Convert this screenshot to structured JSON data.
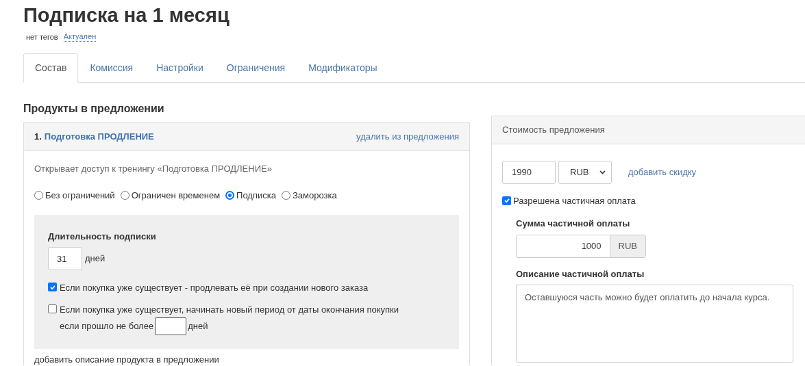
{
  "title": "Подписка на 1 месяц",
  "tags": {
    "label": "нет тегов",
    "status": "Актуален"
  },
  "tabs": [
    {
      "label": "Состав",
      "selected": true
    },
    {
      "label": "Комиссия",
      "selected": false
    },
    {
      "label": "Настройки",
      "selected": false
    },
    {
      "label": "Ограничения",
      "selected": false
    },
    {
      "label": "Модификаторы",
      "selected": false
    }
  ],
  "products": {
    "heading": "Продукты в предложении",
    "items": [
      {
        "number": "1.",
        "name": "Подготовка ПРОДЛЕНИЕ",
        "remove": "удалить из предложения",
        "description": "Открывает доступ к тренингу «Подготовка ПРОДЛЕНИЕ»",
        "access_options": [
          {
            "label": "Без ограничений",
            "selected": false
          },
          {
            "label": "Ограничен временем",
            "selected": false
          },
          {
            "label": "Подписка",
            "selected": true
          },
          {
            "label": "Заморозка",
            "selected": false
          }
        ],
        "subscription": {
          "heading": "Длительность подписки",
          "duration": "31",
          "unit": "дней",
          "options": [
            {
              "label": "Если покупка уже существует - продлевать её при создании нового заказа",
              "checked": true
            },
            {
              "label": "Если покупка уже существует, начинать новый период от даты окончания покупки",
              "label_2": "если прошло не более",
              "unit": "дней",
              "checked": false
            }
          ]
        },
        "add_description": "добавить описание продукта в предложении"
      }
    ]
  },
  "price": {
    "heading": "Стоимость предложения",
    "amount": "1990",
    "currency": "RUB",
    "add_discount": "добавить скидку",
    "partial": {
      "label": "Разрешена частичная оплата",
      "checked": true,
      "amount_label": "Сумма частичной оплаты",
      "amount": "1000",
      "currency": "RUB",
      "description_label": "Описание частичной оплаты",
      "description": "Оставшуюся часть можно будет оплатить до начала курса."
    }
  }
}
